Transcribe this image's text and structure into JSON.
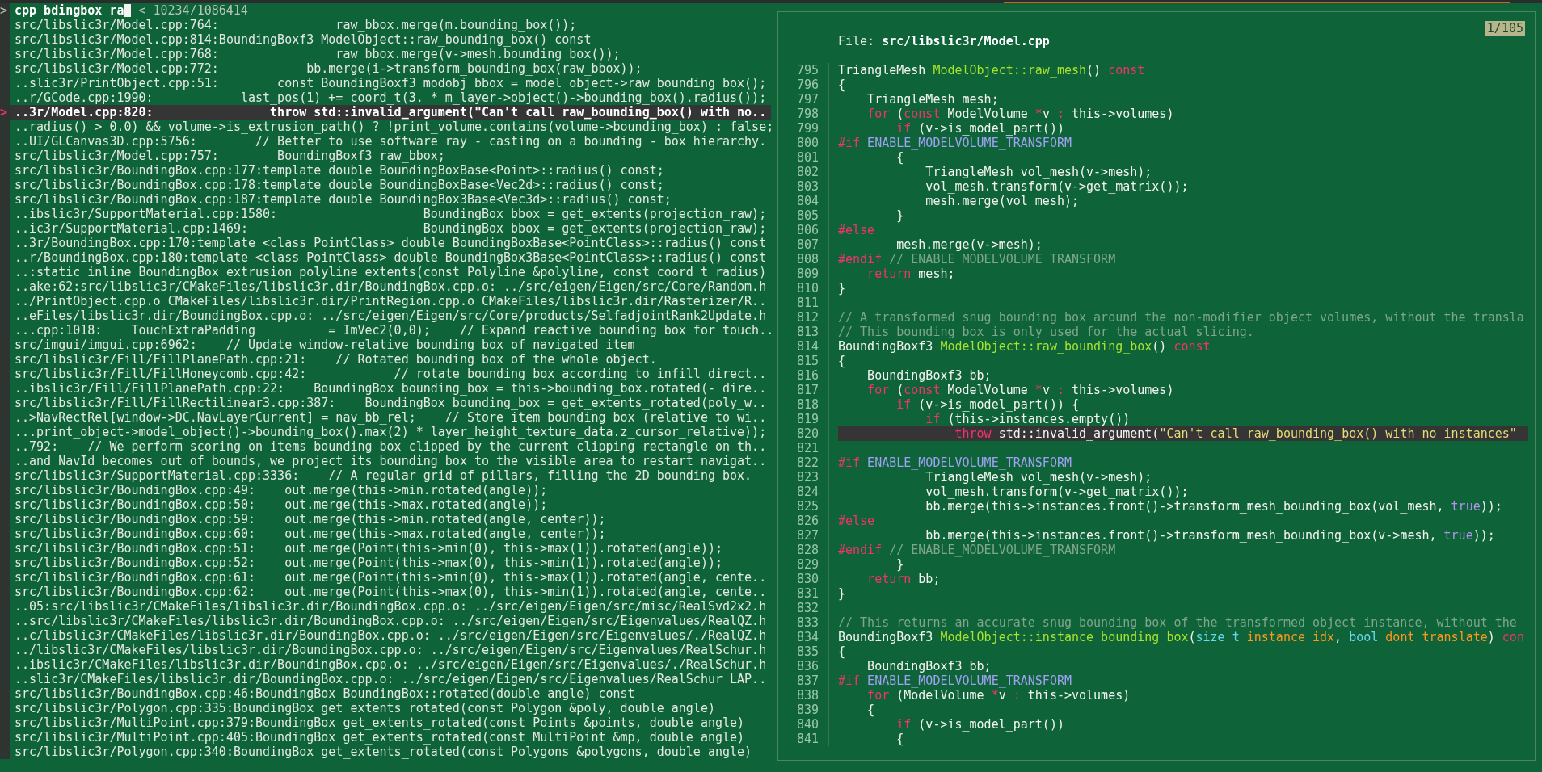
{
  "prompt": {
    "marker": ">",
    "query": "cpp bdingbox ra",
    "separator": "<",
    "count": "10234/1086414"
  },
  "pointer": ">",
  "results": [
    {
      "text": "src/libslic3r/Model.cpp:764:                raw_bbox.merge(m.bounding_box());",
      "selected": false
    },
    {
      "text": "src/libslic3r/Model.cpp:814:BoundingBoxf3 ModelObject::raw_bounding_box() const",
      "selected": false
    },
    {
      "text": "src/libslic3r/Model.cpp:768:                raw_bbox.merge(v->mesh.bounding_box());",
      "selected": false
    },
    {
      "text": "src/libslic3r/Model.cpp:772:            bb.merge(i->transform_bounding_box(raw_bbox));",
      "selected": false
    },
    {
      "text": "..slic3r/PrintObject.cpp:51:        const BoundingBoxf3 modobj_bbox = model_object->raw_bounding_box();",
      "selected": false
    },
    {
      "text": "..r/GCode.cpp:1990:            last_pos(1) += coord_t(3. * m_layer->object()->bounding_box().radius());",
      "selected": false
    },
    {
      "text": "..3r/Model.cpp:820:                throw std::invalid_argument(\"Can't call raw_bounding_box() with no..",
      "selected": true
    },
    {
      "text": "..radius() > 0.0) && volume->is_extrusion_path() ? !print_volume.contains(volume->bounding_box) : false;",
      "selected": false
    },
    {
      "text": "..UI/GLCanvas3D.cpp:5756:        // Better to use software ray - casting on a bounding - box hierarchy.",
      "selected": false
    },
    {
      "text": "src/libslic3r/Model.cpp:757:        BoundingBoxf3 raw_bbox;",
      "selected": false
    },
    {
      "text": "src/libslic3r/BoundingBox.cpp:177:template double BoundingBoxBase<Point>::radius() const;",
      "selected": false
    },
    {
      "text": "src/libslic3r/BoundingBox.cpp:178:template double BoundingBoxBase<Vec2d>::radius() const;",
      "selected": false
    },
    {
      "text": "src/libslic3r/BoundingBox.cpp:187:template double BoundingBox3Base<Vec3d>::radius() const;",
      "selected": false
    },
    {
      "text": "..ibslic3r/SupportMaterial.cpp:1580:                    BoundingBox bbox = get_extents(projection_raw);",
      "selected": false
    },
    {
      "text": "..ic3r/SupportMaterial.cpp:1469:                        BoundingBox bbox = get_extents(projection_raw);",
      "selected": false
    },
    {
      "text": "..3r/BoundingBox.cpp:170:template <class PointClass> double BoundingBoxBase<PointClass>::radius() const",
      "selected": false
    },
    {
      "text": "..r/BoundingBox.cpp:180:template <class PointClass> double BoundingBox3Base<PointClass>::radius() const",
      "selected": false
    },
    {
      "text": "..:static inline BoundingBox extrusion_polyline_extents(const Polyline &polyline, const coord_t radius)",
      "selected": false
    },
    {
      "text": "..ake:62:src/libslic3r/CMakeFiles/libslic3r.dir/BoundingBox.cpp.o: ../src/eigen/Eigen/src/Core/Random.h",
      "selected": false
    },
    {
      "text": "../PrintObject.cpp.o CMakeFiles/libslic3r.dir/PrintRegion.cpp.o CMakeFiles/libslic3r.dir/Rasterizer/R..",
      "selected": false
    },
    {
      "text": "..eFiles/libslic3r.dir/BoundingBox.cpp.o: ../src/eigen/Eigen/src/Core/products/SelfadjointRank2Update.h",
      "selected": false
    },
    {
      "text": "...cpp:1018:    TouchExtraPadding          = ImVec2(0,0);    // Expand reactive bounding box for touch..",
      "selected": false
    },
    {
      "text": "src/imgui/imgui.cpp:6962:    // Update window-relative bounding box of navigated item",
      "selected": false
    },
    {
      "text": "src/libslic3r/Fill/FillPlanePath.cpp:21:    // Rotated bounding box of the whole object.",
      "selected": false
    },
    {
      "text": "src/libslic3r/Fill/FillHoneycomb.cpp:42:            // rotate bounding box according to infill direct..",
      "selected": false
    },
    {
      "text": "..ibslic3r/Fill/FillPlanePath.cpp:22:    BoundingBox bounding_box = this->bounding_box.rotated(- dire..",
      "selected": false
    },
    {
      "text": "src/libslic3r/Fill/FillRectilinear3.cpp:387:    BoundingBox bounding_box = get_extents_rotated(poly_w..",
      "selected": false
    },
    {
      "text": "..>NavRectRel[window->DC.NavLayerCurrent] = nav_bb_rel;    // Store item bounding box (relative to wi..",
      "selected": false
    },
    {
      "text": "...print_object->model_object()->bounding_box().max(2) * layer_height_texture_data.z_cursor_relative));",
      "selected": false
    },
    {
      "text": "..792:    // We perform scoring on items bounding box clipped by the current clipping rectangle on th..",
      "selected": false
    },
    {
      "text": "..and NavId becomes out of bounds, we project its bounding box to the visible area to restart navigat..",
      "selected": false
    },
    {
      "text": "src/libslic3r/SupportMaterial.cpp:3336:    // A regular grid of pillars, filling the 2D bounding box.",
      "selected": false
    },
    {
      "text": "src/libslic3r/BoundingBox.cpp:49:    out.merge(this->min.rotated(angle));",
      "selected": false
    },
    {
      "text": "src/libslic3r/BoundingBox.cpp:50:    out.merge(this->max.rotated(angle));",
      "selected": false
    },
    {
      "text": "src/libslic3r/BoundingBox.cpp:59:    out.merge(this->min.rotated(angle, center));",
      "selected": false
    },
    {
      "text": "src/libslic3r/BoundingBox.cpp:60:    out.merge(this->max.rotated(angle, center));",
      "selected": false
    },
    {
      "text": "src/libslic3r/BoundingBox.cpp:51:    out.merge(Point(this->min(0), this->max(1)).rotated(angle));",
      "selected": false
    },
    {
      "text": "src/libslic3r/BoundingBox.cpp:52:    out.merge(Point(this->max(0), this->min(1)).rotated(angle));",
      "selected": false
    },
    {
      "text": "src/libslic3r/BoundingBox.cpp:61:    out.merge(Point(this->min(0), this->max(1)).rotated(angle, cente..",
      "selected": false
    },
    {
      "text": "src/libslic3r/BoundingBox.cpp:62:    out.merge(Point(this->max(0), this->min(1)).rotated(angle, cente..",
      "selected": false
    },
    {
      "text": "..05:src/libslic3r/CMakeFiles/libslic3r.dir/BoundingBox.cpp.o: ../src/eigen/Eigen/src/misc/RealSvd2x2.h",
      "selected": false
    },
    {
      "text": "..src/libslic3r/CMakeFiles/libslic3r.dir/BoundingBox.cpp.o: ../src/eigen/Eigen/src/Eigenvalues/RealQZ.h",
      "selected": false
    },
    {
      "text": "..c/libslic3r/CMakeFiles/libslic3r.dir/BoundingBox.cpp.o: ../src/eigen/Eigen/src/Eigenvalues/./RealQZ.h",
      "selected": false
    },
    {
      "text": "../libslic3r/CMakeFiles/libslic3r.dir/BoundingBox.cpp.o: ../src/eigen/Eigen/src/Eigenvalues/RealSchur.h",
      "selected": false
    },
    {
      "text": "..ibslic3r/CMakeFiles/libslic3r.dir/BoundingBox.cpp.o: ../src/eigen/Eigen/src/Eigenvalues/./RealSchur.h",
      "selected": false
    },
    {
      "text": "..slic3r/CMakeFiles/libslic3r.dir/BoundingBox.cpp.o: ../src/eigen/Eigen/src/Eigenvalues/RealSchur_LAP..",
      "selected": false
    },
    {
      "text": "src/libslic3r/BoundingBox.cpp:46:BoundingBox BoundingBox::rotated(double angle) const",
      "selected": false
    },
    {
      "text": "src/libslic3r/Polygon.cpp:335:BoundingBox get_extents_rotated(const Polygon &poly, double angle)",
      "selected": false
    },
    {
      "text": "src/libslic3r/MultiPoint.cpp:379:BoundingBox get_extents_rotated(const Points &points, double angle)",
      "selected": false
    },
    {
      "text": "src/libslic3r/MultiPoint.cpp:405:BoundingBox get_extents_rotated(const MultiPoint &mp, double angle)",
      "selected": false
    },
    {
      "text": "src/libslic3r/Polygon.cpp:340:BoundingBox get_extents_rotated(const Polygons &polygons, double angle)",
      "selected": false
    }
  ],
  "preview": {
    "badge": "1/105",
    "file_header": "File: **src/libslic3r/Model.cpp**",
    "lines": [
      {
        "number": "795",
        "selected": false,
        "tokens": [
          {
            "kind": "plain",
            "text": "TriangleMesh "
          },
          {
            "kind": "function",
            "text": "ModelObject::raw_mesh"
          },
          {
            "kind": "plain",
            "text": "() "
          },
          {
            "kind": "keyword",
            "text": "const"
          }
        ]
      },
      {
        "number": "796",
        "selected": false,
        "tokens": [
          {
            "kind": "plain",
            "text": "{"
          }
        ]
      },
      {
        "number": "797",
        "selected": false,
        "tokens": [
          {
            "kind": "plain",
            "text": "    TriangleMesh mesh;"
          }
        ]
      },
      {
        "number": "798",
        "selected": false,
        "tokens": [
          {
            "kind": "keyword",
            "text": "    for"
          },
          {
            "kind": "plain",
            "text": " ("
          },
          {
            "kind": "keyword",
            "text": "const"
          },
          {
            "kind": "plain",
            "text": " ModelVolume "
          },
          {
            "kind": "keyword",
            "text": "*"
          },
          {
            "kind": "plain",
            "text": "v "
          },
          {
            "kind": "keyword",
            "text": ":"
          },
          {
            "kind": "plain",
            "text": " this->volumes)"
          }
        ]
      },
      {
        "number": "799",
        "selected": false,
        "tokens": [
          {
            "kind": "keyword",
            "text": "        if"
          },
          {
            "kind": "plain",
            "text": " (v->is_model_part())"
          }
        ]
      },
      {
        "number": "800",
        "selected": false,
        "tokens": [
          {
            "kind": "keyword",
            "text": "#if"
          },
          {
            "kind": "macro",
            "text": " ENABLE_MODELVOLUME_TRANSFORM"
          }
        ]
      },
      {
        "number": "801",
        "selected": false,
        "tokens": [
          {
            "kind": "plain",
            "text": "        {"
          }
        ]
      },
      {
        "number": "802",
        "selected": false,
        "tokens": [
          {
            "kind": "plain",
            "text": "            TriangleMesh vol_mesh(v->mesh);"
          }
        ]
      },
      {
        "number": "803",
        "selected": false,
        "tokens": [
          {
            "kind": "plain",
            "text": "            vol_mesh.transform(v->get_matrix());"
          }
        ]
      },
      {
        "number": "804",
        "selected": false,
        "tokens": [
          {
            "kind": "plain",
            "text": "            mesh.merge(vol_mesh);"
          }
        ]
      },
      {
        "number": "805",
        "selected": false,
        "tokens": [
          {
            "kind": "plain",
            "text": "        }"
          }
        ]
      },
      {
        "number": "806",
        "selected": false,
        "tokens": [
          {
            "kind": "keyword",
            "text": "#else"
          }
        ]
      },
      {
        "number": "807",
        "selected": false,
        "tokens": [
          {
            "kind": "plain",
            "text": "        mesh.merge(v->mesh);"
          }
        ]
      },
      {
        "number": "808",
        "selected": false,
        "tokens": [
          {
            "kind": "keyword",
            "text": "#endif"
          },
          {
            "kind": "comment",
            "text": " // ENABLE_MODELVOLUME_TRANSFORM"
          }
        ]
      },
      {
        "number": "809",
        "selected": false,
        "tokens": [
          {
            "kind": "keyword",
            "text": "    return"
          },
          {
            "kind": "plain",
            "text": " mesh;"
          }
        ]
      },
      {
        "number": "810",
        "selected": false,
        "tokens": [
          {
            "kind": "plain",
            "text": "}"
          }
        ]
      },
      {
        "number": "811",
        "selected": false
      },
      {
        "number": "812",
        "selected": false,
        "tokens": [
          {
            "kind": "comment",
            "text": "// A transformed snug bounding box around the non-modifier object volumes, without the transla"
          }
        ]
      },
      {
        "number": "813",
        "selected": false,
        "tokens": [
          {
            "kind": "comment",
            "text": "// This bounding box is only used for the actual slicing."
          }
        ]
      },
      {
        "number": "814",
        "selected": false,
        "tokens": [
          {
            "kind": "plain",
            "text": "BoundingBoxf3 "
          },
          {
            "kind": "function",
            "text": "ModelObject::raw_bounding_box"
          },
          {
            "kind": "plain",
            "text": "() "
          },
          {
            "kind": "keyword",
            "text": "const"
          }
        ]
      },
      {
        "number": "815",
        "selected": false,
        "tokens": [
          {
            "kind": "plain",
            "text": "{"
          }
        ]
      },
      {
        "number": "816",
        "selected": false,
        "tokens": [
          {
            "kind": "plain",
            "text": "    BoundingBoxf3 bb;"
          }
        ]
      },
      {
        "number": "817",
        "selected": false,
        "tokens": [
          {
            "kind": "keyword",
            "text": "    for"
          },
          {
            "kind": "plain",
            "text": " ("
          },
          {
            "kind": "keyword",
            "text": "const"
          },
          {
            "kind": "plain",
            "text": " ModelVolume "
          },
          {
            "kind": "keyword",
            "text": "*"
          },
          {
            "kind": "plain",
            "text": "v "
          },
          {
            "kind": "keyword",
            "text": ":"
          },
          {
            "kind": "plain",
            "text": " this->volumes)"
          }
        ]
      },
      {
        "number": "818",
        "selected": false,
        "tokens": [
          {
            "kind": "keyword",
            "text": "        if"
          },
          {
            "kind": "plain",
            "text": " (v->is_model_part()) {"
          }
        ]
      },
      {
        "number": "819",
        "selected": false,
        "tokens": [
          {
            "kind": "keyword",
            "text": "            if"
          },
          {
            "kind": "plain",
            "text": " (this->instances.empty())"
          }
        ]
      },
      {
        "number": "820",
        "selected": true,
        "tokens": [
          {
            "kind": "keyword",
            "text": "                throw"
          },
          {
            "kind": "plain",
            "text": " std::invalid_argument("
          },
          {
            "kind": "string",
            "text": "\"Can't call raw_bounding_box() with no instances\""
          }
        ]
      },
      {
        "number": "821",
        "selected": false
      },
      {
        "number": "822",
        "selected": false,
        "tokens": [
          {
            "kind": "keyword",
            "text": "#if"
          },
          {
            "kind": "macro",
            "text": " ENABLE_MODELVOLUME_TRANSFORM"
          }
        ]
      },
      {
        "number": "823",
        "selected": false,
        "tokens": [
          {
            "kind": "plain",
            "text": "            TriangleMesh vol_mesh(v->mesh);"
          }
        ]
      },
      {
        "number": "824",
        "selected": false,
        "tokens": [
          {
            "kind": "plain",
            "text": "            vol_mesh.transform(v->get_matrix());"
          }
        ]
      },
      {
        "number": "825",
        "selected": false,
        "tokens": [
          {
            "kind": "plain",
            "text": "            bb.merge(this->instances.front()->transform_mesh_bounding_box(vol_mesh, "
          },
          {
            "kind": "literal",
            "text": "true"
          },
          {
            "kind": "plain",
            "text": "));"
          }
        ]
      },
      {
        "number": "826",
        "selected": false,
        "tokens": [
          {
            "kind": "keyword",
            "text": "#else"
          }
        ]
      },
      {
        "number": "827",
        "selected": false,
        "tokens": [
          {
            "kind": "plain",
            "text": "            bb.merge(this->instances.front()->transform_mesh_bounding_box(v->mesh, "
          },
          {
            "kind": "literal",
            "text": "true"
          },
          {
            "kind": "plain",
            "text": "));"
          }
        ]
      },
      {
        "number": "828",
        "selected": false,
        "tokens": [
          {
            "kind": "keyword",
            "text": "#endif"
          },
          {
            "kind": "comment",
            "text": " // ENABLE_MODELVOLUME_TRANSFORM"
          }
        ]
      },
      {
        "number": "829",
        "selected": false,
        "tokens": [
          {
            "kind": "plain",
            "text": "        }"
          }
        ]
      },
      {
        "number": "830",
        "selected": false,
        "tokens": [
          {
            "kind": "keyword",
            "text": "    return"
          },
          {
            "kind": "plain",
            "text": " bb;"
          }
        ]
      },
      {
        "number": "831",
        "selected": false,
        "tokens": [
          {
            "kind": "plain",
            "text": "}"
          }
        ]
      },
      {
        "number": "832",
        "selected": false
      },
      {
        "number": "833",
        "selected": false,
        "tokens": [
          {
            "kind": "comment",
            "text": "// This returns an accurate snug bounding box of the transformed object instance, without the"
          }
        ]
      },
      {
        "number": "834",
        "selected": false,
        "tokens": [
          {
            "kind": "plain",
            "text": "BoundingBoxf3 "
          },
          {
            "kind": "function",
            "text": "ModelObject::instance_bounding_box"
          },
          {
            "kind": "plain",
            "text": "("
          },
          {
            "kind": "type",
            "text": "size_t"
          },
          {
            "kind": "param",
            "text": " instance_idx"
          },
          {
            "kind": "plain",
            "text": ", "
          },
          {
            "kind": "type",
            "text": "bool"
          },
          {
            "kind": "param",
            "text": " dont_translate"
          },
          {
            "kind": "plain",
            "text": ") "
          },
          {
            "kind": "keyword",
            "text": "con"
          }
        ]
      },
      {
        "number": "835",
        "selected": false,
        "tokens": [
          {
            "kind": "plain",
            "text": "{"
          }
        ]
      },
      {
        "number": "836",
        "selected": false,
        "tokens": [
          {
            "kind": "plain",
            "text": "    BoundingBoxf3 bb;"
          }
        ]
      },
      {
        "number": "837",
        "selected": false,
        "tokens": [
          {
            "kind": "keyword",
            "text": "#if"
          },
          {
            "kind": "macro",
            "text": " ENABLE_MODELVOLUME_TRANSFORM"
          }
        ]
      },
      {
        "number": "838",
        "selected": false,
        "tokens": [
          {
            "kind": "keyword",
            "text": "    for"
          },
          {
            "kind": "plain",
            "text": " (ModelVolume "
          },
          {
            "kind": "keyword",
            "text": "*"
          },
          {
            "kind": "plain",
            "text": "v "
          },
          {
            "kind": "keyword",
            "text": ":"
          },
          {
            "kind": "plain",
            "text": " this->volumes)"
          }
        ]
      },
      {
        "number": "839",
        "selected": false,
        "tokens": [
          {
            "kind": "plain",
            "text": "    {"
          }
        ]
      },
      {
        "number": "840",
        "selected": false,
        "tokens": [
          {
            "kind": "keyword",
            "text": "        if"
          },
          {
            "kind": "plain",
            "text": " (v->is_model_part())"
          }
        ]
      },
      {
        "number": "841",
        "selected": false,
        "tokens": [
          {
            "kind": "plain",
            "text": "        {"
          }
        ]
      }
    ]
  }
}
